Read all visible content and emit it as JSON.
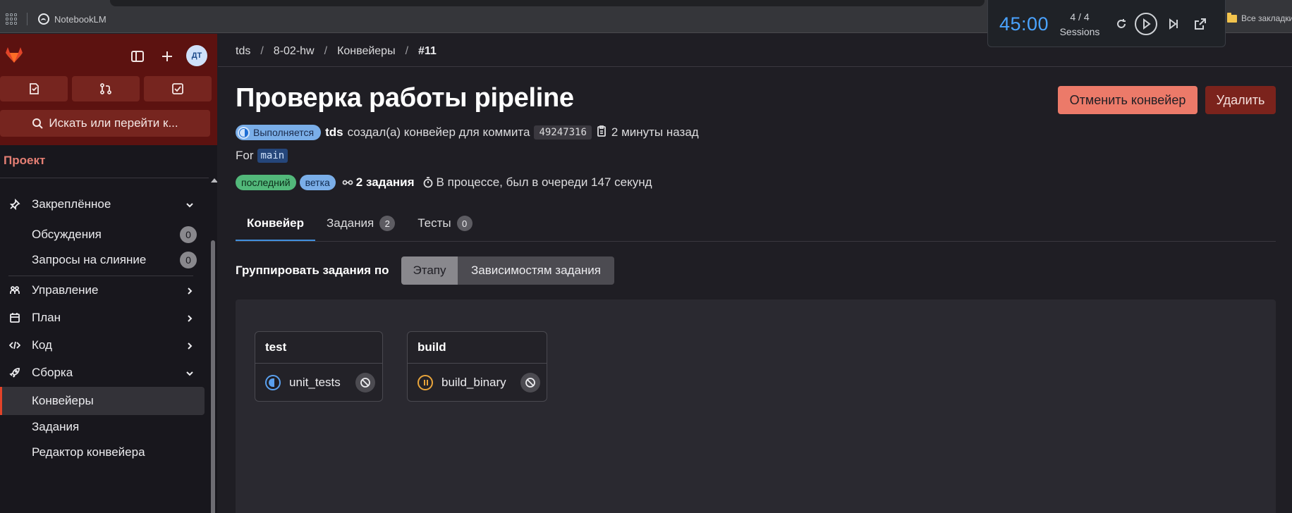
{
  "browser": {
    "bookmark_notebook": "NotebookLM",
    "bookmark_all": "Все закладки"
  },
  "timer": {
    "time": "45:00",
    "count": "4 / 4",
    "label": "Sessions",
    "accent_color": "#4aa3ff"
  },
  "sidebar": {
    "avatar": "ДТ",
    "search": "Искать или перейти к...",
    "section_title": "Проект",
    "items": [
      {
        "label": "Закреплённое",
        "icon": "pin-icon",
        "chevron": "down"
      },
      {
        "label": "Обсуждения",
        "count": "0"
      },
      {
        "label": "Запросы на слияние",
        "count": "0"
      },
      {
        "label": "Управление",
        "icon": "briefcase-icon",
        "chevron": "right"
      },
      {
        "label": "План",
        "icon": "calendar-icon",
        "chevron": "right"
      },
      {
        "label": "Код",
        "icon": "code-icon",
        "chevron": "right"
      },
      {
        "label": "Сборка",
        "icon": "rocket-icon",
        "chevron": "down"
      },
      {
        "label": "Конвейеры",
        "active": true
      },
      {
        "label": "Задания"
      },
      {
        "label": "Редактор конвейера"
      }
    ],
    "accent_color": "#e24329"
  },
  "breadcrumb": [
    "tds",
    "8-02-hw",
    "Конвейеры",
    "#11"
  ],
  "header": {
    "title": "Проверка работы pipeline",
    "cancel_label": "Отменить конвейер",
    "delete_label": "Удалить"
  },
  "meta": {
    "status": "Выполняется",
    "author": "tds",
    "created_text": "создал(а) конвейер для коммита",
    "commit_sha": "49247316",
    "time_ago": "2 минуты назад",
    "for_label": "For",
    "branch": "main",
    "tag_latest": "последний",
    "tag_branch": "ветка",
    "jobs_count": "2 задания",
    "duration": "В процессе, был в очереди 147 секунд"
  },
  "tabs": [
    {
      "label": "Конвейер",
      "active": true
    },
    {
      "label": "Задания",
      "count": "2"
    },
    {
      "label": "Тесты",
      "count": "0"
    }
  ],
  "group": {
    "label": "Группировать задания по",
    "option_stage": "Этапу",
    "option_deps": "Зависимостям задания",
    "selected": "Этапу"
  },
  "graph": {
    "stages": [
      {
        "name": "test",
        "jobs": [
          {
            "name": "unit_tests",
            "status": "running"
          }
        ]
      },
      {
        "name": "build",
        "jobs": [
          {
            "name": "build_binary",
            "status": "pending"
          }
        ]
      }
    ]
  }
}
